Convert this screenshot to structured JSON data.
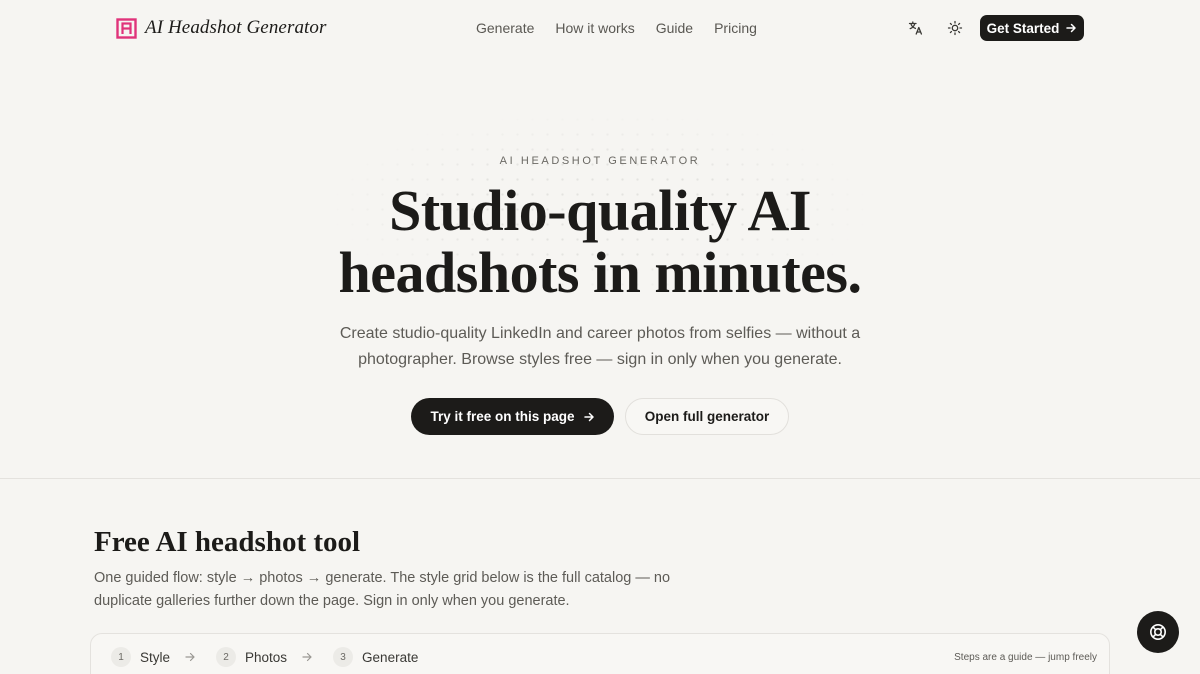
{
  "header": {
    "brand_name": "AI Headshot Generator",
    "nav": [
      {
        "label": "Generate"
      },
      {
        "label": "How it works"
      },
      {
        "label": "Guide"
      },
      {
        "label": "Pricing"
      }
    ],
    "translate_icon": "translate-icon",
    "theme_icon": "sun-icon",
    "cta_label": "Get Started"
  },
  "hero": {
    "eyebrow": "AI HEADSHOT GENERATOR",
    "title_line1": "Studio-quality AI",
    "title_line2": "headshots in minutes.",
    "subtitle": "Create studio-quality LinkedIn and career photos from selfies — without a photographer. Browse styles free — sign in only when you generate.",
    "primary_cta": "Try it free on this page",
    "secondary_cta": "Open full generator"
  },
  "tool": {
    "title": "Free AI headshot tool",
    "description": "One guided flow: style → photos → generate. The style grid below is the full catalog — no duplicate galleries further down the page. Sign in only when you generate.",
    "steps": [
      {
        "num": "1",
        "label": "Style"
      },
      {
        "num": "2",
        "label": "Photos"
      },
      {
        "num": "3",
        "label": "Generate"
      }
    ],
    "hint": "Steps are a guide — jump freely"
  },
  "help_icon": "lifebuoy-icon",
  "colors": {
    "background": "#f6f5f2",
    "ink": "#1c1b19",
    "brand_pink": "#e0337a"
  }
}
